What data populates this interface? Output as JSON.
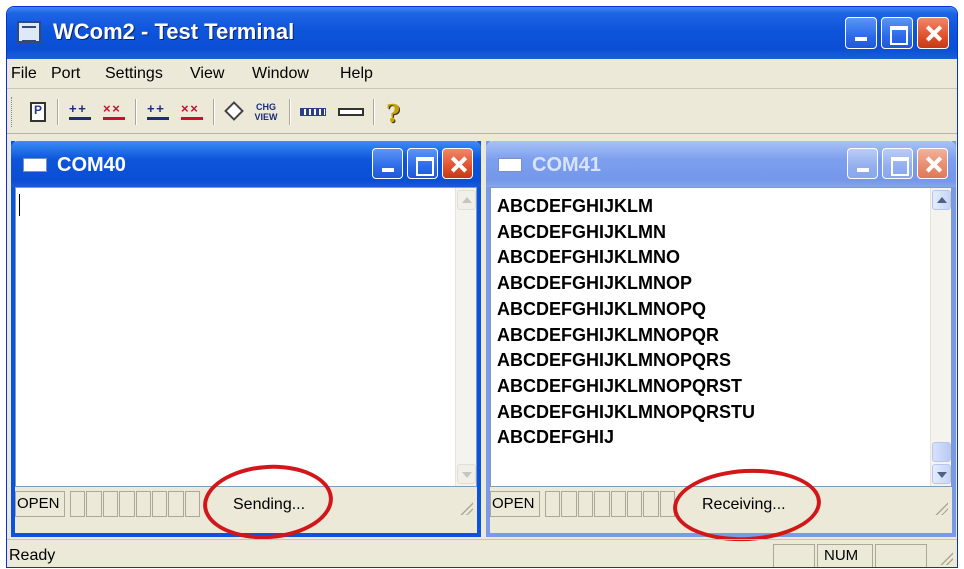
{
  "app": {
    "title": "WCom2 - Test Terminal"
  },
  "menu": [
    "File",
    "Port",
    "Settings",
    "View",
    "Window",
    "Help"
  ],
  "toolbar": {
    "icons": [
      "document-icon",
      "connect-icon",
      "disconnect-icon",
      "connect-all-icon",
      "disconnect-all-icon",
      "eraser-icon",
      "change-view-icon",
      "filled-bar-icon",
      "empty-bar-icon",
      "help-icon"
    ],
    "chg_label": "CHG\nVIEW"
  },
  "com40": {
    "title": "COM40",
    "lines": [],
    "status_open": "OPEN",
    "status_text": "Sending..."
  },
  "com41": {
    "title": "COM41",
    "lines": [
      "ABCDEFGHIJKLM",
      "ABCDEFGHIJKLMN",
      "ABCDEFGHIJKLMNO",
      "ABCDEFGHIJKLMNOP",
      "ABCDEFGHIJKLMNOPQ",
      "ABCDEFGHIJKLMNOPQR",
      "ABCDEFGHIJKLMNOPQRS",
      "ABCDEFGHIJKLMNOPQRST",
      "ABCDEFGHIJKLMNOPQRSTU",
      "ABCDEFGHIJ"
    ],
    "status_open": "OPEN",
    "status_text": "Receiving..."
  },
  "statusbar": {
    "ready": "Ready",
    "num": "NUM"
  },
  "colors": {
    "titlebar": "#0a4ed4",
    "highlight_circle": "#d2161a",
    "face": "#ece9d8"
  }
}
